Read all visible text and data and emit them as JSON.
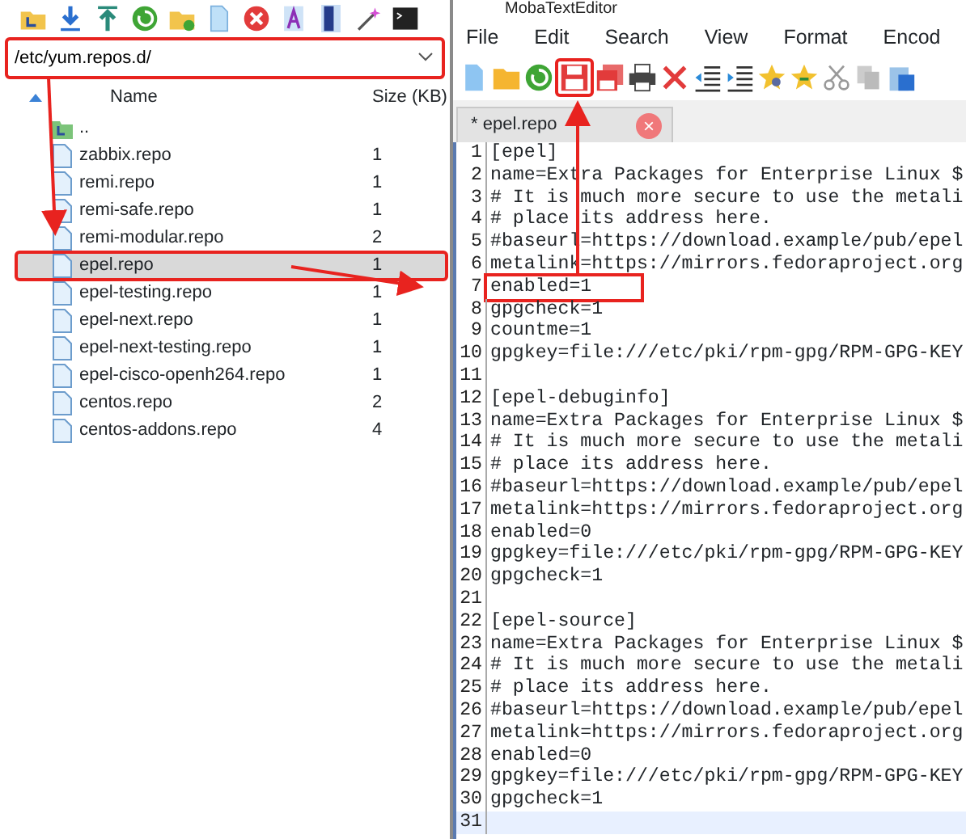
{
  "file_browser": {
    "path": {
      "value": "/etc/yum.repos.d/",
      "highlighted": true
    },
    "columns": [
      "Name",
      "Size (KB)"
    ],
    "files": [
      {
        "kind": "parent",
        "name": "..",
        "selected": false,
        "highlighted": false
      },
      {
        "kind": "file",
        "name": "zabbix.repo",
        "size": "1",
        "selected": false,
        "highlighted": false
      },
      {
        "kind": "file",
        "name": "remi.repo",
        "size": "1",
        "selected": false,
        "highlighted": false
      },
      {
        "kind": "file",
        "name": "remi-safe.repo",
        "size": "1",
        "selected": false,
        "highlighted": false
      },
      {
        "kind": "file",
        "name": "remi-modular.repo",
        "size": "2",
        "selected": false,
        "highlighted": false
      },
      {
        "kind": "file",
        "name": "epel.repo",
        "size": "1",
        "selected": true,
        "highlighted": true
      },
      {
        "kind": "file",
        "name": "epel-testing.repo",
        "size": "1",
        "selected": false,
        "highlighted": false
      },
      {
        "kind": "file",
        "name": "epel-next.repo",
        "size": "1",
        "selected": false,
        "highlighted": false
      },
      {
        "kind": "file",
        "name": "epel-next-testing.repo",
        "size": "1",
        "selected": false,
        "highlighted": false
      },
      {
        "kind": "file",
        "name": "epel-cisco-openh264.repo",
        "size": "1",
        "selected": false,
        "highlighted": false
      },
      {
        "kind": "file",
        "name": "centos.repo",
        "size": "2",
        "selected": false,
        "highlighted": false
      },
      {
        "kind": "file",
        "name": "centos-addons.repo",
        "size": "4",
        "selected": false,
        "highlighted": false
      }
    ]
  },
  "editor": {
    "window": {
      "title": "MobaTextEditor"
    },
    "menu": [
      "File",
      "Edit",
      "Search",
      "View",
      "Format",
      "Encod"
    ],
    "tab": {
      "label": "* epel.repo",
      "close": "×"
    },
    "lines": [
      {
        "number": "1",
        "text": "[epel]",
        "highlighted": false,
        "current": false
      },
      {
        "number": "2",
        "text": "name=Extra Packages for Enterprise Linux $",
        "highlighted": false,
        "current": false
      },
      {
        "number": "3",
        "text": "# It is much more secure to use the metali",
        "highlighted": false,
        "current": false
      },
      {
        "number": "4",
        "text": "# place its address here.",
        "highlighted": false,
        "current": false
      },
      {
        "number": "5",
        "text": "#baseurl=https://download.example/pub/epel",
        "highlighted": false,
        "current": false
      },
      {
        "number": "6",
        "text": "metalink=https://mirrors.fedoraproject.org",
        "highlighted": false,
        "current": false
      },
      {
        "number": "7",
        "text": "enabled=1",
        "highlighted": true,
        "current": false
      },
      {
        "number": "8",
        "text": "gpgcheck=1",
        "highlighted": false,
        "current": false
      },
      {
        "number": "9",
        "text": "countme=1",
        "highlighted": false,
        "current": false
      },
      {
        "number": "10",
        "text": "gpgkey=file:///etc/pki/rpm-gpg/RPM-GPG-KEY",
        "highlighted": false,
        "current": false
      },
      {
        "number": "11",
        "highlighted": false,
        "current": false
      },
      {
        "number": "12",
        "text": "[epel-debuginfo]",
        "highlighted": false,
        "current": false
      },
      {
        "number": "13",
        "text": "name=Extra Packages for Enterprise Linux $",
        "highlighted": false,
        "current": false
      },
      {
        "number": "14",
        "text": "# It is much more secure to use the metali",
        "highlighted": false,
        "current": false
      },
      {
        "number": "15",
        "text": "# place its address here.",
        "highlighted": false,
        "current": false
      },
      {
        "number": "16",
        "text": "#baseurl=https://download.example/pub/epel",
        "highlighted": false,
        "current": false
      },
      {
        "number": "17",
        "text": "metalink=https://mirrors.fedoraproject.org",
        "highlighted": false,
        "current": false
      },
      {
        "number": "18",
        "text": "enabled=0",
        "highlighted": false,
        "current": false
      },
      {
        "number": "19",
        "text": "gpgkey=file:///etc/pki/rpm-gpg/RPM-GPG-KEY",
        "highlighted": false,
        "current": false
      },
      {
        "number": "20",
        "text": "gpgcheck=1",
        "highlighted": false,
        "current": false
      },
      {
        "number": "21",
        "highlighted": false,
        "current": false
      },
      {
        "number": "22",
        "text": "[epel-source]",
        "highlighted": false,
        "current": false
      },
      {
        "number": "23",
        "text": "name=Extra Packages for Enterprise Linux $",
        "highlighted": false,
        "current": false
      },
      {
        "number": "24",
        "text": "# It is much more secure to use the metali",
        "highlighted": false,
        "current": false
      },
      {
        "number": "25",
        "text": "# place its address here.",
        "highlighted": false,
        "current": false
      },
      {
        "number": "26",
        "text": "#baseurl=https://download.example/pub/epel",
        "highlighted": false,
        "current": false
      },
      {
        "number": "27",
        "text": "metalink=https://mirrors.fedoraproject.org",
        "highlighted": false,
        "current": false
      },
      {
        "number": "28",
        "text": "enabled=0",
        "highlighted": false,
        "current": false
      },
      {
        "number": "29",
        "text": "gpgkey=file:///etc/pki/rpm-gpg/RPM-GPG-KEY",
        "highlighted": false,
        "current": false
      },
      {
        "number": "30",
        "text": "gpgcheck=1",
        "highlighted": false,
        "current": false
      },
      {
        "number": "31",
        "highlighted": false,
        "current": true
      }
    ]
  }
}
